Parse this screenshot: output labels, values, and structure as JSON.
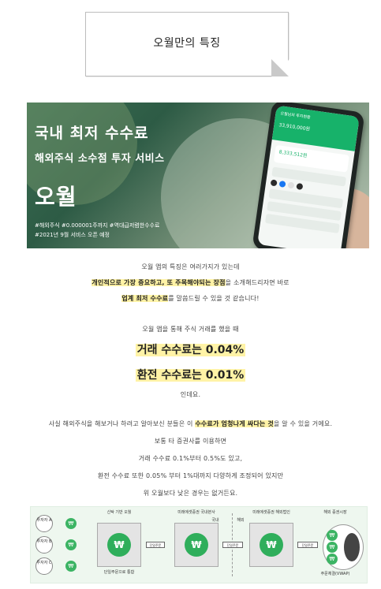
{
  "section_title": "오월만의 특징",
  "banner": {
    "headline": "국내 최저 수수료",
    "subline": "해외주식 소수점 투자 서비스",
    "brand": "오월",
    "tags_line1": "#해외주식 #0.000001주까지 #역대급저렴한수수료",
    "tags_line2": "#2021년 9월 서비스 오픈 예정",
    "phone_header": "오월님의 투자현황",
    "phone_amount": "33,910,000원",
    "phone_card_amount": "8,333,512원"
  },
  "intro": {
    "line1": "오월 앱의 특징은 여러가지가 있는데",
    "line2_highlight": "개인적으로 가장 중요하고, 또 주목해야되는 장점",
    "line2_rest": "을 소개해드리자면 바로",
    "line3_highlight": "업계 최저 수수료",
    "line3_rest": "를 말씀드릴 수 있을 것 같습니다!"
  },
  "fees": {
    "lead": "오월 앱을 통해 주식 거래를 했을 때",
    "trade_fee": "거래 수수료는 0.04%",
    "exchange_fee": "환전 수수료는 0.01%",
    "tail": "인데요."
  },
  "compare": {
    "line1_pre": "사실 해외주식을 해보거나 하려고 알아보신 분들은 이 ",
    "line1_highlight": "수수료가 엄청나게 싸다는 것",
    "line1_post": "을 알 수 있을 거에요.",
    "line2": "보통 타 증권사를 이용하면",
    "line3": "거래 수수료 0.1%부터 0.5%도 있고,",
    "line4": "환전 수수료 또한 0.05% 부터 1%대까지 다양하게 조정되어 있지만",
    "line5": "위 오월보다 낮은 경우는 없거든요."
  },
  "diagram": {
    "investors": [
      "투자자 A",
      "투자자 B",
      "투자자 C"
    ],
    "won_symbol": "₩",
    "box1_top": "신탁 기반 오월",
    "box1_bottom": "단일주문으로 통합",
    "arrow1": "단일주문",
    "box2_top": "미래에셋증권 국내본사",
    "domestic_label": "국내",
    "overseas_label": "해외",
    "arrow2": "단일주문",
    "box3_top": "미래에셋증권 해외법인",
    "arrow3": "단일주문",
    "market_top": "해외 증권시장",
    "market_bottom": "주문체결(VWAP)"
  }
}
